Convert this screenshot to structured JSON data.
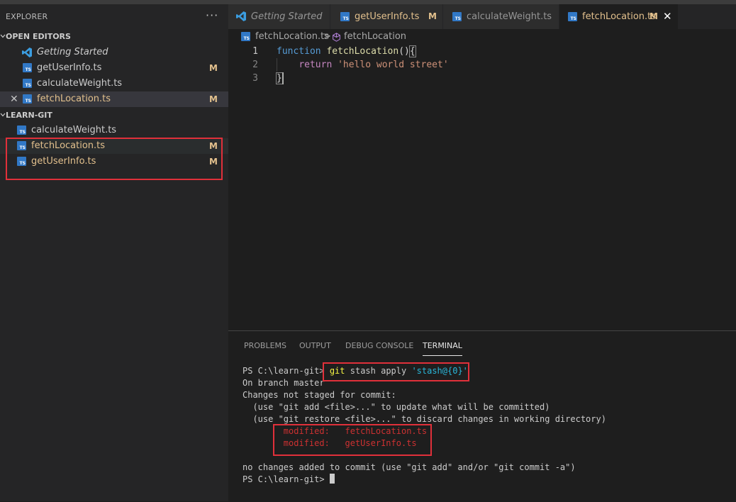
{
  "explorer": {
    "title": "EXPLORER",
    "more": "···",
    "open_editors": {
      "title": "OPEN EDITORS",
      "items": [
        {
          "label": "Getting Started",
          "badge": ""
        },
        {
          "label": "getUserInfo.ts",
          "badge": "M"
        },
        {
          "label": "calculateWeight.ts",
          "badge": ""
        },
        {
          "label": "fetchLocation.ts",
          "badge": "M"
        }
      ]
    },
    "folder": {
      "title": "LEARN-GIT",
      "items": [
        {
          "label": "calculateWeight.ts",
          "badge": ""
        },
        {
          "label": "fetchLocation.ts",
          "badge": "M"
        },
        {
          "label": "getUserInfo.ts",
          "badge": "M"
        }
      ]
    }
  },
  "tabs": [
    {
      "label": "Getting Started",
      "badge": ""
    },
    {
      "label": "getUserInfo.ts",
      "badge": "M"
    },
    {
      "label": "calculateWeight.ts",
      "badge": ""
    },
    {
      "label": "fetchLocation.ts",
      "badge": "M",
      "close": "✕"
    }
  ],
  "breadcrumb": {
    "file": "fetchLocation.ts",
    "separator": ">",
    "symbol": "fetchLocation"
  },
  "editor": {
    "line_numbers": [
      "1",
      "2",
      "3"
    ],
    "line1": {
      "kw": "function",
      "fn": "fetchLocation",
      "paren": "()",
      "brace": "{"
    },
    "line2": {
      "kw": "return",
      "str": "'hello world street'"
    },
    "line3": {
      "brace": "}"
    }
  },
  "panel": {
    "tabs": [
      "PROBLEMS",
      "OUTPUT",
      "DEBUG CONSOLE",
      "TERMINAL"
    ],
    "terminal": {
      "prompt": "PS C:\\learn-git>",
      "cmd_git": "git",
      "cmd_rest": " stash apply ",
      "cmd_arg": "'stash@{0}'",
      "lines": [
        "On branch master",
        "Changes not staged for commit:",
        "  (use \"git add <file>...\" to update what will be committed)",
        "  (use \"git restore <file>...\" to discard changes in working directory)"
      ],
      "modified": [
        "        modified:   fetchLocation.ts",
        "        modified:   getUserInfo.ts"
      ],
      "footer": "no changes added to commit (use \"git add\" and/or \"git commit -a\")",
      "final_prompt": "PS C:\\learn-git> "
    }
  }
}
